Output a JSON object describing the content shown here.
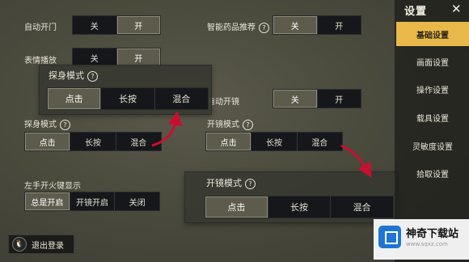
{
  "left_settings": {
    "auto_door": {
      "label": "自动开门",
      "options": [
        "关",
        "开"
      ],
      "selected": 1
    },
    "emote_play": {
      "label": "表情播放",
      "options": [
        "关",
        "开"
      ],
      "selected": 1
    },
    "peek_mode": {
      "label": "探身模式",
      "options": [
        "点击",
        "长按",
        "混合"
      ],
      "selected": 0
    },
    "left_fire_display": {
      "label": "左手开火键显示",
      "options": [
        "总是开启",
        "开镜开启",
        "关闭"
      ],
      "selected": 0
    }
  },
  "right_settings": {
    "smart_meds": {
      "label": "智能药品推荐",
      "options": [
        "关",
        "开"
      ],
      "selected": 0
    },
    "auto_open_scope": {
      "label": "自动开镜",
      "options": [
        "关",
        "开"
      ],
      "selected": 0
    },
    "scope_mode": {
      "label": "开镜模式",
      "options": [
        "点击",
        "长按",
        "混合"
      ],
      "selected": 0
    }
  },
  "zoom_peek_panel": {
    "label": "探身模式",
    "options": [
      "点击",
      "长按",
      "混合"
    ],
    "selected": 0
  },
  "zoom_scope_panel": {
    "label": "开镜模式",
    "options": [
      "点击",
      "长按",
      "混合"
    ],
    "selected": 0
  },
  "help_glyph": "?",
  "side_menu": {
    "title": "设置",
    "close_glyph": "✕",
    "items": [
      "基础设置",
      "画面设置",
      "操作设置",
      "载具设置",
      "灵敏度设置",
      "拾取设置"
    ],
    "active_index": 0
  },
  "logout": {
    "label": "退出登录",
    "avatar_glyph": "🐧"
  },
  "watermark": {
    "name": "神奇下载站",
    "url": "www.sqxz.com"
  },
  "colors": {
    "accent": "#e8b84a",
    "arrow": "#c8102e",
    "segment_bg": "#15171a",
    "selected_bg": "#5d5b4c"
  }
}
